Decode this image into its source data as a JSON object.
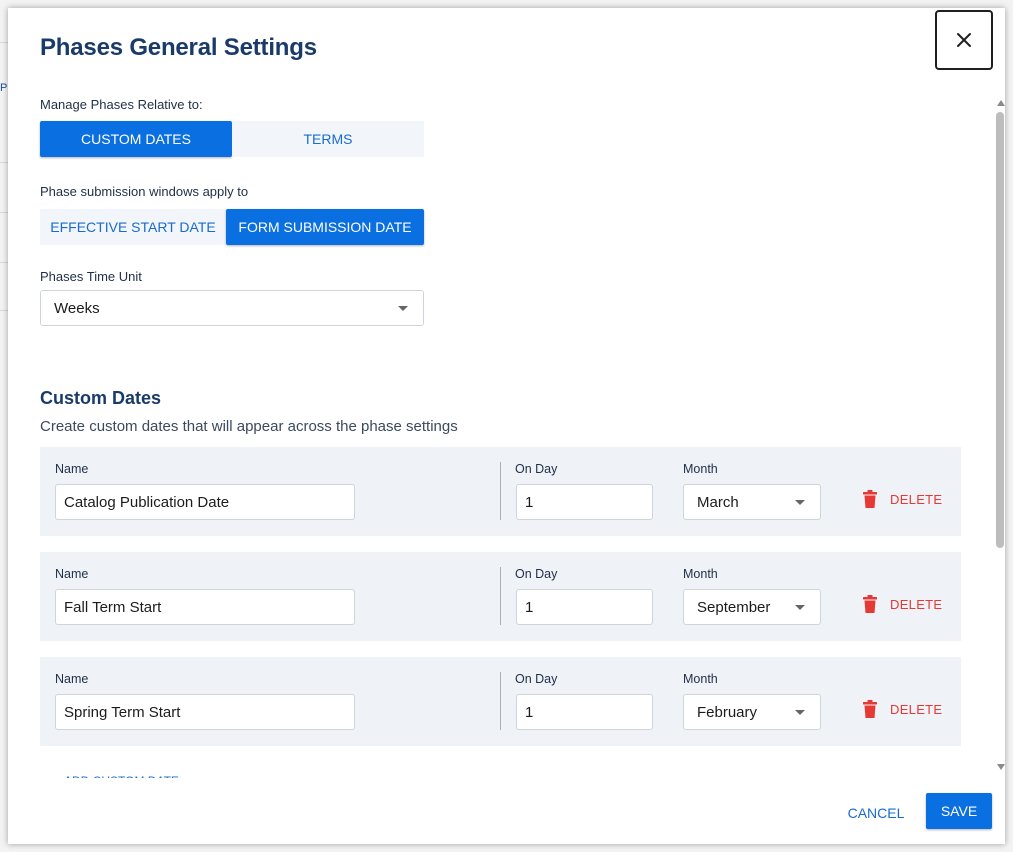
{
  "background": {
    "peek_text": "PH"
  },
  "dialog": {
    "title": "Phases General Settings",
    "close_icon": "close-icon"
  },
  "manage_relative": {
    "label": "Manage Phases Relative to:",
    "options": [
      "CUSTOM DATES",
      "TERMS"
    ],
    "selected": "CUSTOM DATES"
  },
  "submission_windows": {
    "label": "Phase submission windows apply to",
    "options": [
      "EFFECTIVE START DATE",
      "FORM SUBMISSION DATE"
    ],
    "selected": "FORM SUBMISSION DATE"
  },
  "time_unit": {
    "label": "Phases Time Unit",
    "value": "Weeks"
  },
  "custom_dates": {
    "title": "Custom Dates",
    "description": "Create custom dates that will appear across the phase settings",
    "labels": {
      "name": "Name",
      "day": "On Day",
      "month": "Month",
      "delete": "DELETE"
    },
    "rows": [
      {
        "name": "Catalog Publication Date",
        "day": "1",
        "month": "March"
      },
      {
        "name": "Fall Term Start",
        "day": "1",
        "month": "September"
      },
      {
        "name": "Spring Term Start",
        "day": "1",
        "month": "February"
      }
    ],
    "add_label": "ADD CUSTOM DATE"
  },
  "footer": {
    "cancel": "CANCEL",
    "save": "SAVE"
  },
  "colors": {
    "primary": "#0a6fe0",
    "title": "#1a3a6a",
    "danger": "#e53935",
    "row_bg": "#eff2f6"
  }
}
